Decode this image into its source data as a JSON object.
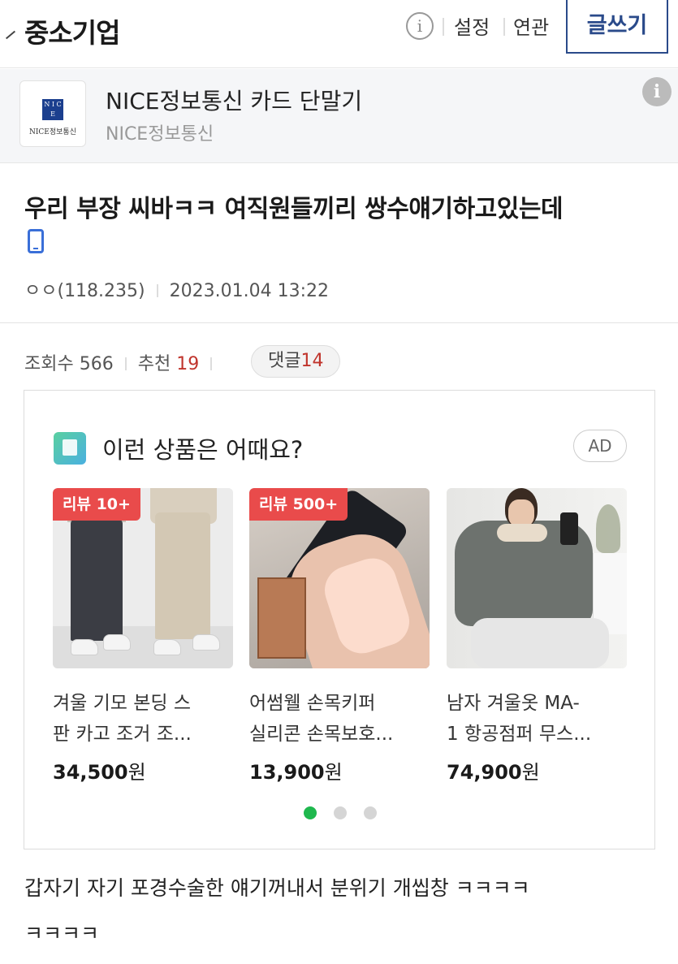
{
  "header": {
    "board_title": "중소기업",
    "info_icon": "i",
    "settings_label": "설정",
    "related_label": "연관",
    "write_label": "글쓰기"
  },
  "ad_banner": {
    "logo_mark": "N I C E",
    "logo_text": "NICE정보통신",
    "title": "NICE정보통신 카드 단말기",
    "subtitle": "NICE정보통신",
    "info_icon": "i"
  },
  "post": {
    "title": "우리 부장 씨바ㅋㅋ 여직원들끼리 쌍수얘기하고있는데",
    "author": "ㅇㅇ(118.235)",
    "datetime": "2023.01.04 13:22",
    "views_label": "조회수",
    "views": "566",
    "recommend_label": "추천",
    "recommend": "19",
    "comments_label": "댓글",
    "comments": "14",
    "body_line1": "갑자기 자기 포경수술한 얘기꺼내서 분위기 개씹창 ㅋㅋㅋㅋ",
    "body_line2": "ㅋㅋㅋㅋ"
  },
  "products": {
    "heading": "이런 상품은 어때요?",
    "ad_label": "AD",
    "items": [
      {
        "badge": "리뷰 10+",
        "name_line1": "겨울 기모 본딩 스",
        "name_line2": "판 카고 조거 조...",
        "price": "34,500",
        "currency": "원"
      },
      {
        "badge": "리뷰 500+",
        "name_line1": "어썸웰 손목키퍼",
        "name_line2": "실리콘 손목보호...",
        "price": "13,900",
        "currency": "원"
      },
      {
        "badge": "",
        "name_line1": "남자 겨울옷 MA-",
        "name_line2": "1 항공점퍼 무스...",
        "price": "74,900",
        "currency": "원"
      }
    ],
    "pager_active_index": 0,
    "pager_count": 3
  },
  "colors": {
    "accent_blue": "#2a4a8a",
    "red_count": "#c0342c",
    "badge_red": "#e94b4b",
    "pager_green": "#1fb84e"
  }
}
